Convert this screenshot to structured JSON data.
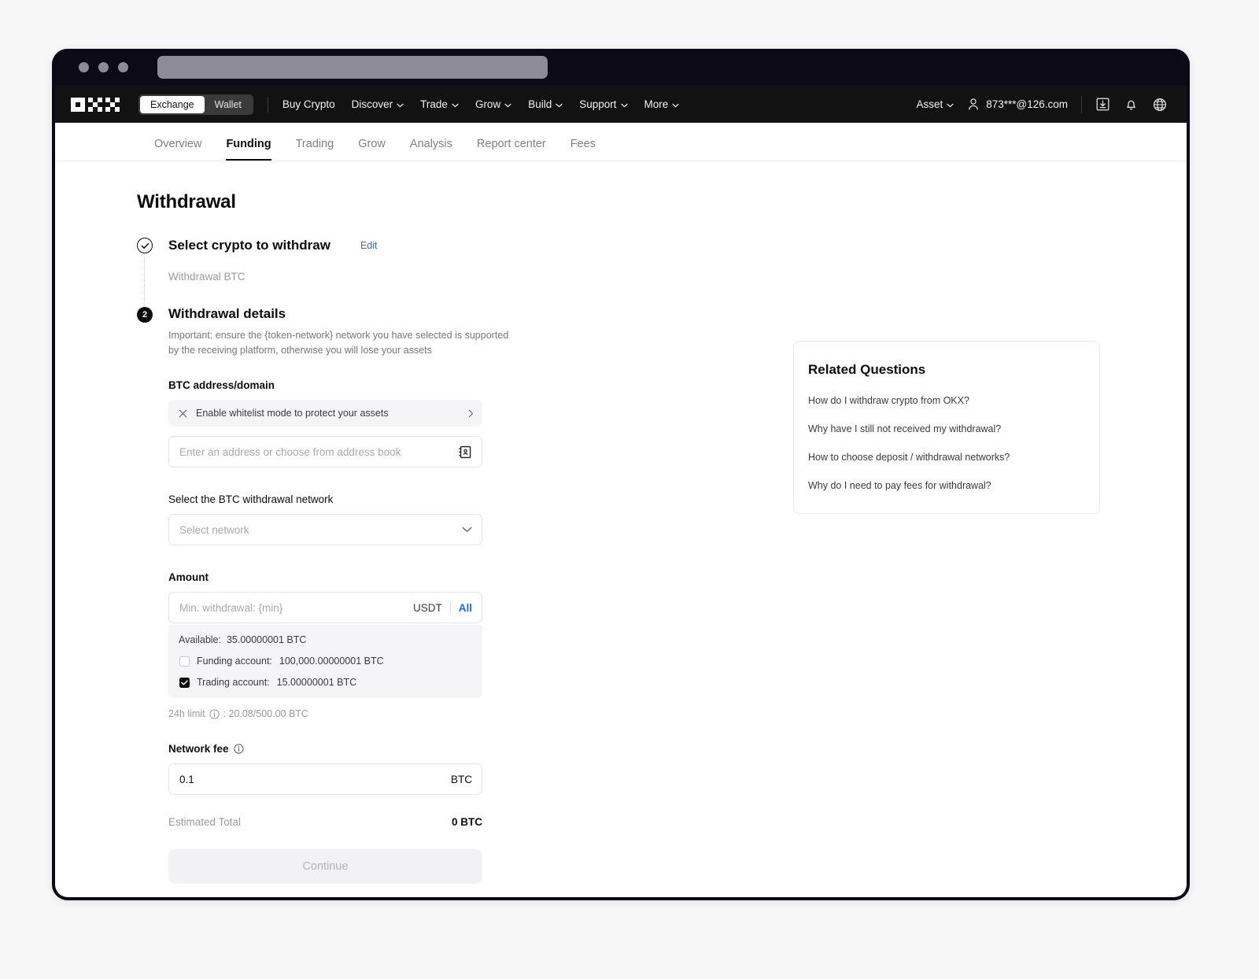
{
  "browser": {
    "url_placeholder": ""
  },
  "topnav": {
    "logo": "okx-logo",
    "toggle": {
      "exchange": "Exchange",
      "wallet": "Wallet",
      "active": "Exchange"
    },
    "links": [
      {
        "label": "Buy Crypto",
        "caret": false
      },
      {
        "label": "Discover",
        "caret": true
      },
      {
        "label": "Trade",
        "caret": true
      },
      {
        "label": "Grow",
        "caret": true
      },
      {
        "label": "Build",
        "caret": true
      },
      {
        "label": "Support",
        "caret": true
      },
      {
        "label": "More",
        "caret": true
      }
    ],
    "asset_label": "Asset",
    "account_email": "873***@126.com",
    "icons": [
      "download-icon",
      "bell-icon",
      "globe-icon"
    ]
  },
  "subnav": {
    "items": [
      {
        "label": "Overview",
        "active": false
      },
      {
        "label": "Funding",
        "active": true
      },
      {
        "label": "Trading",
        "active": false
      },
      {
        "label": "Grow",
        "active": false
      },
      {
        "label": "Analysis",
        "active": false
      },
      {
        "label": "Report center",
        "active": false
      },
      {
        "label": "Fees",
        "active": false
      }
    ]
  },
  "main": {
    "page_title": "Withdrawal",
    "step1": {
      "heading": "Select crypto to withdraw",
      "edit_label": "Edit",
      "summary": "Withdrawal BTC"
    },
    "step2": {
      "number": "2",
      "heading": "Withdrawal details",
      "description": "Important: ensure the {token-network} network you have selected is supported by the receiving platform, otherwise you will lose your assets",
      "address": {
        "label": "BTC address/domain",
        "whitelist_banner": "Enable whitelist mode to protect your assets",
        "input_placeholder": "Enter an address or choose from address book"
      },
      "network": {
        "label": "Select the BTC withdrawal network",
        "select_placeholder": "Select network"
      },
      "amount": {
        "label": "Amount",
        "input_placeholder": "Min. withdrawal: {min}",
        "unit": "USDT",
        "all_label": "All",
        "available_label": "Available:",
        "available_value": "35.00000001 BTC",
        "accounts": [
          {
            "label": "Funding account:",
            "value": "100,000.00000001 BTC",
            "checked": false
          },
          {
            "label": "Trading account:",
            "value": "15.00000001 BTC",
            "checked": true
          }
        ],
        "limit_label": "24h limit",
        "limit_value": ": 20.08/500.00 BTC"
      },
      "network_fee": {
        "label": "Network fee",
        "value": "0.1",
        "unit": "BTC"
      },
      "estimated_total": {
        "label": "Estimated Total",
        "value": "0 BTC"
      },
      "continue_label": "Continue"
    }
  },
  "related": {
    "title": "Related Questions",
    "items": [
      "How do I withdraw crypto from OKX?",
      "Why have I still not received my withdrawal?",
      "How to choose deposit / withdrawal networks?",
      "Why do I need to pay fees for withdrawal?"
    ]
  },
  "colors": {
    "accent_blue": "#1a6aff",
    "nav_dark": "#121212",
    "frame_dark": "#0d0a18",
    "muted_text": "#9a9a9e"
  }
}
